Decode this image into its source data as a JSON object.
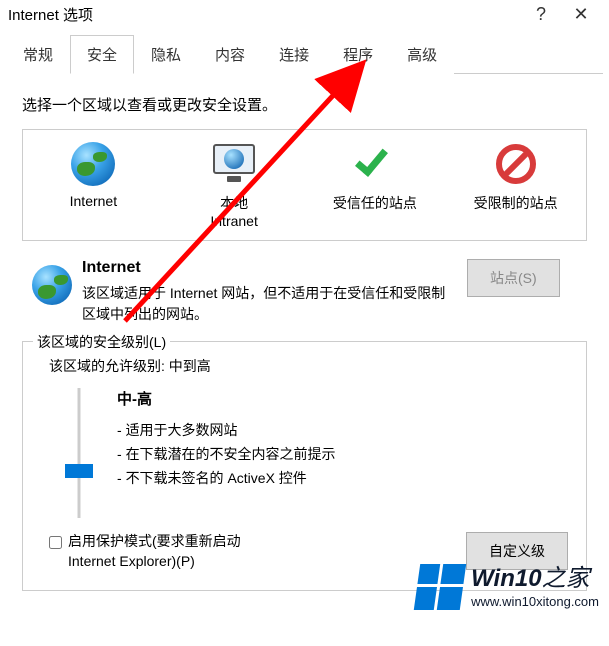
{
  "title": "Internet 选项",
  "titlebar": {
    "help": "?",
    "close": "✕"
  },
  "tabs": [
    "常规",
    "安全",
    "隐私",
    "内容",
    "连接",
    "程序",
    "高级"
  ],
  "active_tab_index": 1,
  "prompt": "选择一个区域以查看或更改安全设置。",
  "zones": [
    {
      "label": "Internet"
    },
    {
      "label": "本地\nIntranet"
    },
    {
      "label": "受信任的站点"
    },
    {
      "label": "受限制的站点"
    }
  ],
  "selected_zone": {
    "name": "Internet",
    "desc": "该区域适用于 Internet 网站，但不适用于在受信任和受限制区域中列出的网站。",
    "sites_button": "站点(S)"
  },
  "security_level": {
    "legend": "该区域的安全级别(L)",
    "allowed": "该区域的允许级别: 中到高",
    "level_name": "中-高",
    "bullets": [
      "适用于大多数网站",
      "在下载潜在的不安全内容之前提示",
      "不下载未签名的 ActiveX 控件"
    ]
  },
  "protected_mode": {
    "label": "启用保护模式(要求重新启动 Internet Explorer)(P)",
    "checked": false
  },
  "custom_button": "自定义级",
  "watermark": {
    "main": "Win10",
    "suffix": "之家",
    "url": "www.win10xitong.com"
  }
}
